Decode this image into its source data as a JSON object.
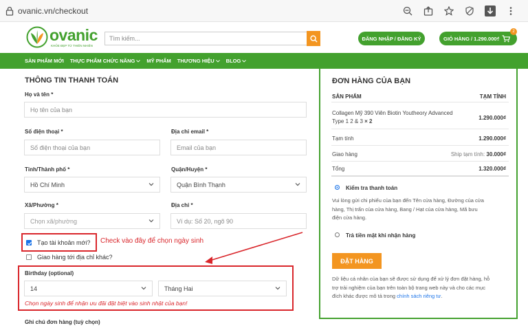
{
  "browser": {
    "url": "ovanic.vn/checkout"
  },
  "header": {
    "logo_text": "ovanic",
    "logo_tagline": "KHỎE ĐẸP TỪ THIÊN NHIÊN",
    "search_placeholder": "Tìm kiếm...",
    "login_label": "ĐĂNG NHẬP / ĐĂNG KÝ",
    "cart_label": "GIỎ HÀNG / 1.290.000₫",
    "cart_count": "2"
  },
  "nav": {
    "items": [
      "SẢN PHẨM MỚI",
      "THỰC PHẨM CHỨC NĂNG",
      "MỸ PHẨM",
      "THƯƠNG HIỆU",
      "BLOG"
    ]
  },
  "billing": {
    "title": "THÔNG TIN THANH TOÁN",
    "name_label": "Họ và tên *",
    "name_placeholder": "Họ tên của bạn",
    "phone_label": "Số điện thoại *",
    "phone_placeholder": "Số điện thoại của bạn",
    "email_label": "Địa chỉ email *",
    "email_placeholder": "Email của bạn",
    "city_label": "Tỉnh/Thành phố *",
    "city_value": "Hồ Chí Minh",
    "district_label": "Quận/Huyện *",
    "district_value": "Quận Bình Thạnh",
    "ward_label": "Xã/Phường *",
    "ward_value": "Chọn xã/phường",
    "address_label": "Địa chỉ *",
    "address_placeholder": "Ví dụ: Số 20, ngõ 90",
    "create_account_label": "Tạo tài khoản mới?",
    "ship_other_label": "Giao hàng tới địa chỉ khác?",
    "annotation": "Check vào đây để chọn ngày sinh",
    "birthday_label": "Birthday (optional)",
    "birthday_day": "14",
    "birthday_month": "Tháng Hai",
    "birthday_hint": "Chọn ngày sinh để nhận ưu đãi đặt biệt vào sinh nhật của bạn!",
    "notes_label": "Ghi chú đơn hàng (tuỳ chọn)"
  },
  "order": {
    "title": "ĐƠN HÀNG CỦA BẠN",
    "col_product": "SẢN PHẨM",
    "col_subtotal": "TẠM TÍNH",
    "product_line1": "Collagen Mỹ 390 Viên Biotin Youtheory Advanced",
    "product_line2": "Type 1 2 & 3",
    "product_qty": "× 2",
    "product_price": "1.290.000₫",
    "subtotal_label": "Tạm tính",
    "subtotal_value": "1.290.000₫",
    "shipping_label": "Giao hàng",
    "shipping_desc": "Ship tạm tính:",
    "shipping_value": "30.000₫",
    "total_label": "Tổng",
    "total_value": "1.320.000₫",
    "pay_check_label": "Kiểm tra thanh toán",
    "pay_check_desc_1": "Vui lòng gửi chi phiếu của bạn đến Tên cửa hàng, Đường của cửa",
    "pay_check_desc_2": "hàng, Thị trấn của cửa hàng, Bang / Hạt của cửa hàng, Mã bưu",
    "pay_check_desc_3": "điện cửa hàng.",
    "pay_cod_label": "Trả tiền mặt khi nhận hàng",
    "order_button": "ĐẶT HÀNG",
    "privacy_1": "Dữ liệu cá nhân của bạn sẽ được sử dụng để xử lý đơn đặt hàng, hỗ",
    "privacy_2": "trợ trải nghiệm của bạn trên toàn bộ trang web này và cho các mục",
    "privacy_3_pre": "đích khác được mô tả trong",
    "privacy_link": "chính sách riêng tư",
    "privacy_end": "."
  },
  "colors": {
    "brand_green": "#43a12e",
    "accent_orange": "#f39520",
    "annotation_red": "#d9262b"
  }
}
